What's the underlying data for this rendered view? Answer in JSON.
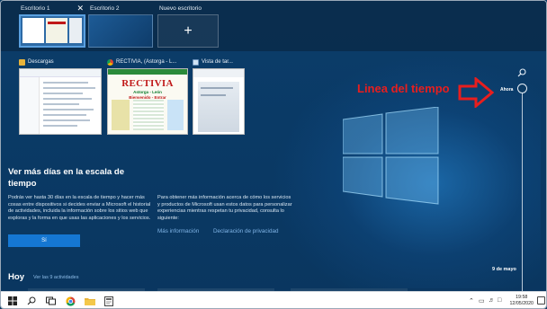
{
  "desktops": [
    {
      "label": "Escritorio 1",
      "close": "✕"
    },
    {
      "label": "Escritorio 2"
    },
    {
      "label": "Nuevo escritorio",
      "plus": "+"
    }
  ],
  "windows": [
    {
      "title": "Descargas",
      "icon": "folder-down-icon"
    },
    {
      "title": "RECTIVIA, (Astorga - L...",
      "icon": "chrome-icon",
      "thumb_title": "RECTIVIA",
      "thumb_sub": "Astorga - León",
      "thumb_sub2": "Bienvenido - Entrar"
    },
    {
      "title": "Vista de tar...",
      "icon": "task-view-icon"
    }
  ],
  "info": {
    "heading": "Ver más días en la escala de tiempo",
    "para1": "Podrás ver hasta 30 días en la escala de tiempo y hacer más cosas entre dispositivos si decides enviar a Microsoft el historial de actividades, incluida la información sobre los sitios web que exploras y la forma en que usas las aplicaciones y los servicios.",
    "para2": "Para obtener más información acerca de cómo los servicios y productos de Microsoft usan estos datos para personalizar experiencias mientras respetan tu privacidad, consulta lo siguiente:",
    "yes_button": "Sí",
    "link_more": "Más información",
    "link_privacy": "Declaración de privacidad"
  },
  "today": {
    "label": "Hoy",
    "link": "Ver las 9 actividades"
  },
  "timeline": {
    "now_label": "Ahora",
    "date_label": "9 de mayo"
  },
  "annotation": {
    "text": "Linea del tiempo",
    "color": "#e81e1e"
  },
  "taskbar": {
    "time": "19:58",
    "date": "12/05/2020",
    "icons": [
      "windows-start-icon",
      "search-icon",
      "task-view-icon",
      "chrome-icon",
      "file-explorer-icon",
      "app-icon"
    ]
  },
  "colors": {
    "background": "#0b3a63",
    "accent": "#1577d3",
    "link": "#7fb4e6"
  }
}
